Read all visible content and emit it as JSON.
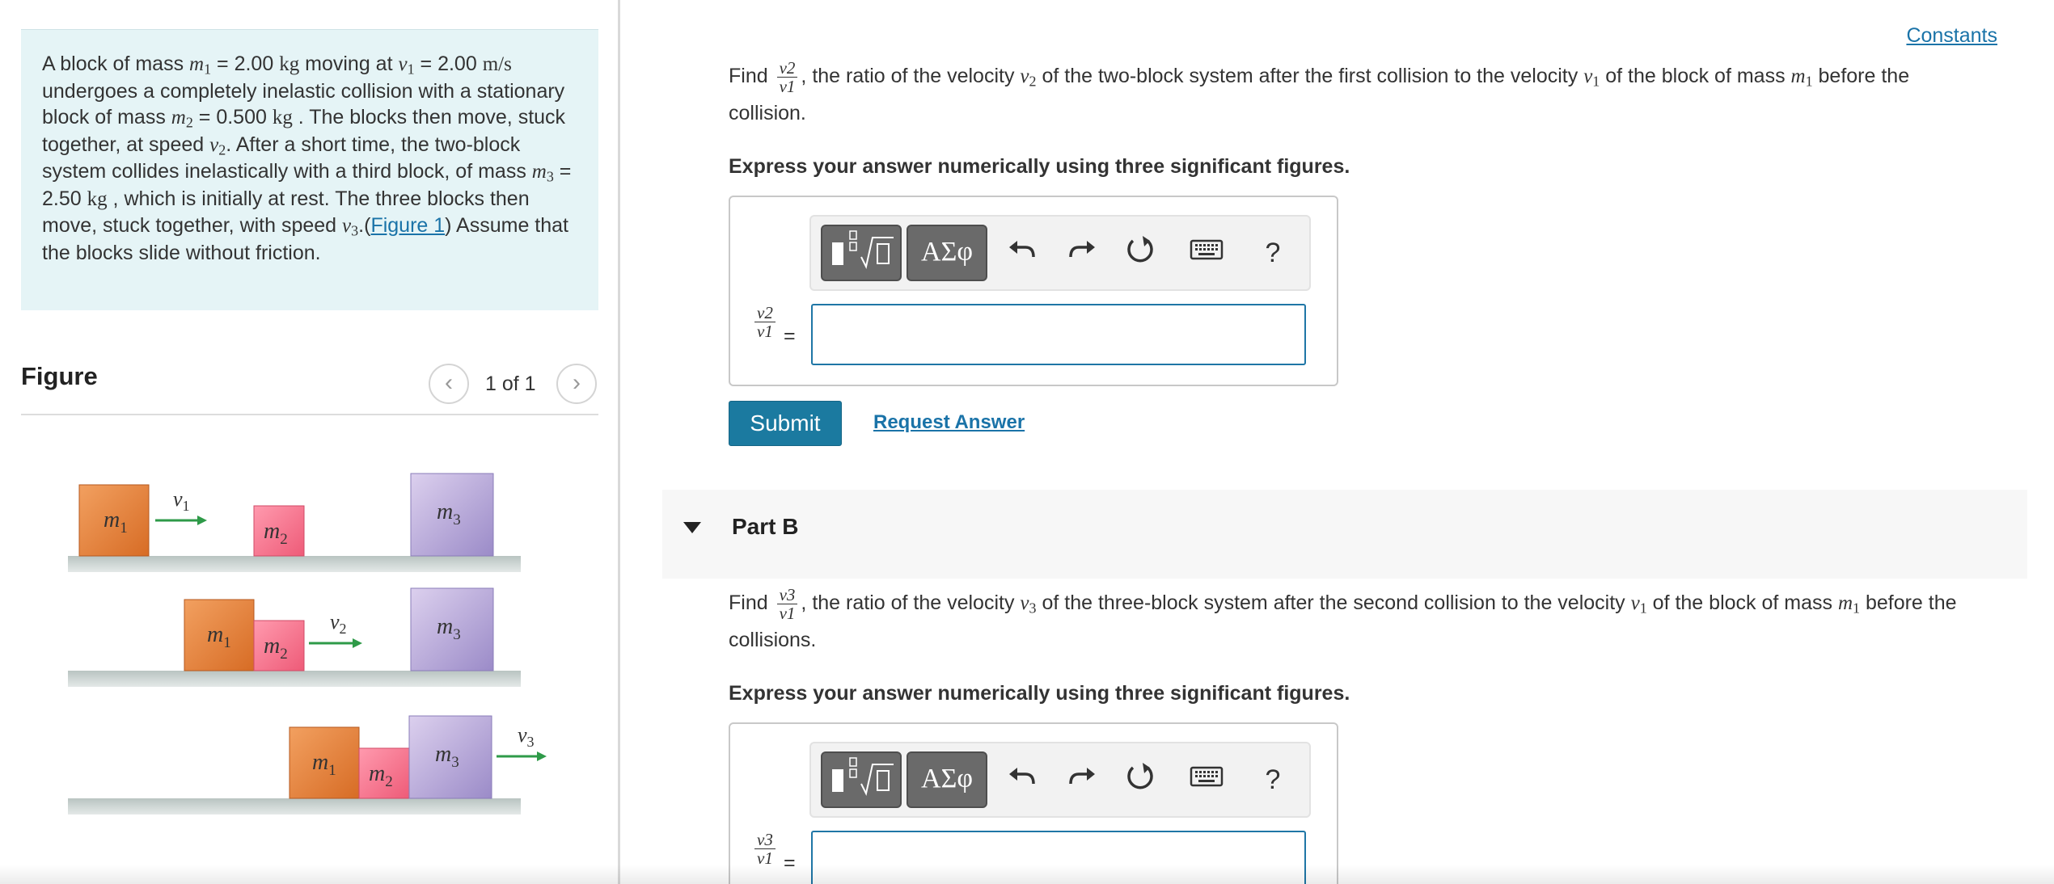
{
  "problem": {
    "intro": "A block of mass ",
    "m1_sym": "m",
    "m1_sub": "1",
    "t1": " = 2.00 ",
    "unit_kg": "kg",
    "t2": " moving at ",
    "v1_sym": "v",
    "v1_sub": "1",
    "t3": " = 2.00 ",
    "unit_ms": "m/s",
    "t4": " undergoes a completely inelastic collision with a stationary block of mass ",
    "m2_sym": "m",
    "m2_sub": "2",
    "t5": " = 0.500 ",
    "t6": " . The blocks then move, stuck together, at speed ",
    "v2_sym": "v",
    "v2_sub": "2",
    "t7": ". After a short time, the two-block system collides inelastically with a third block, of mass ",
    "m3_sym": "m",
    "m3_sub": "3",
    "t8": " = 2.50 ",
    "t9": " , which is initially at rest. The three blocks then move, stuck together, with speed ",
    "v3_sym": "v",
    "v3_sub": "3",
    "t10": ".(",
    "figure_link": "Figure 1",
    "t11": ") Assume that the blocks slide without friction."
  },
  "figure": {
    "title": "Figure",
    "counter": "1 of 1",
    "prev_icon": "chevron-left-icon",
    "next_icon": "chevron-right-icon",
    "labels": {
      "m": "m",
      "v": "v",
      "s1": "1",
      "s2": "2",
      "s3": "3"
    },
    "colors": {
      "block_m1": "#e07b35",
      "block_m2": "#f26f87",
      "block_m3": "#a89ccf",
      "arrow": "#2e9a48",
      "floor": "#c5cfcc"
    }
  },
  "constants_link": "Constants",
  "part_a": {
    "q_find": "Find ",
    "frac_num": "v2",
    "frac_den": "v1",
    "q_rest_1": ", the ratio of the velocity ",
    "q_v2": "v",
    "q_v2_sub": "2",
    "q_rest_2": " of the two-block system after the first collision to the velocity ",
    "q_v1": "v",
    "q_v1_sub": "1",
    "q_rest_3": " of the block of mass ",
    "q_m1": "m",
    "q_m1_sub": "1",
    "q_rest_4": " before the collision.",
    "instruction": "Express your answer numerically using three significant figures.",
    "equals": "=",
    "input_value": "",
    "submit": "Submit",
    "request_answer": "Request Answer"
  },
  "part_b": {
    "title": "Part B",
    "q_find": "Find ",
    "frac_num": "v3",
    "frac_den": "v1",
    "q_rest_1": ", the ratio of the velocity ",
    "q_v3": "v",
    "q_v3_sub": "3",
    "q_rest_2": " of the three-block system after the second collision to the velocity ",
    "q_v1": "v",
    "q_v1_sub": "1",
    "q_rest_3": " of the block of mass ",
    "q_m1": "m",
    "q_m1_sub": "1",
    "q_rest_4": " before the collisions.",
    "instruction": "Express your answer numerically using three significant figures.",
    "equals": "=",
    "input_value": ""
  },
  "toolbar": {
    "symbols_label": "ΑΣφ",
    "help_label": "?",
    "icons": [
      "templates-icon",
      "greek-symbols-icon",
      "undo-icon",
      "redo-icon",
      "reset-icon",
      "keyboard-icon",
      "help-icon"
    ]
  }
}
